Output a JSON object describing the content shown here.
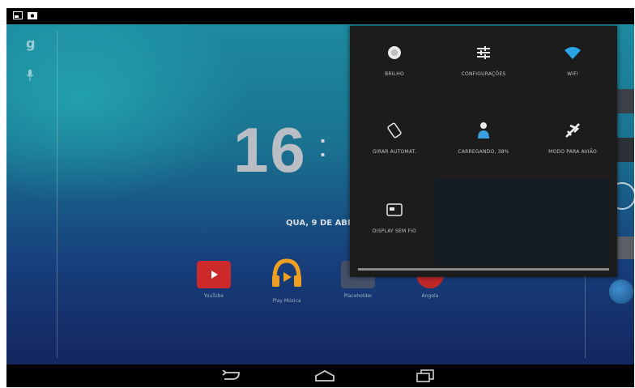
{
  "status_bar": {
    "icons": [
      "screenshot-icon",
      "gallery-icon"
    ]
  },
  "home": {
    "clock": "16",
    "clock_partial": ":",
    "date": "QUA, 9 DE ABR",
    "left_icons": [
      "google-g-icon",
      "microphone-icon"
    ],
    "apps": [
      {
        "label": "YouTube",
        "icon": "youtube-icon",
        "color": "#cc2a2a"
      },
      {
        "label": "Play Música",
        "icon": "play-music-icon",
        "color": "#f0a020"
      },
      {
        "label": "Placeholder",
        "icon": "app-icon",
        "color": "#445068"
      },
      {
        "label": "Angola",
        "icon": "app-icon",
        "color": "#c02828"
      }
    ]
  },
  "quick_settings": {
    "tiles": [
      {
        "label": "BRILHO",
        "icon": "brightness-icon"
      },
      {
        "label": "CONFIGURAÇÕES",
        "icon": "settings-sliders-icon"
      },
      {
        "label": "WIFI",
        "icon": "wifi-icon"
      },
      {
        "label": "GIRAR AUTOMAT.",
        "icon": "auto-rotate-icon"
      },
      {
        "label": "CARREGANDO, 38%",
        "icon": "user-icon"
      },
      {
        "label": "MODO PARA AVIÃO",
        "icon": "airplane-icon"
      },
      {
        "label": "DISPLAY SEM FIO",
        "icon": "cast-icon"
      }
    ],
    "battery_percent": 38
  },
  "nav_bar": {
    "buttons": [
      "back-icon",
      "home-icon",
      "recents-icon"
    ]
  },
  "colors": {
    "accent_wifi": "#2aa6e8",
    "panel_bg": "#1c1c1c"
  }
}
